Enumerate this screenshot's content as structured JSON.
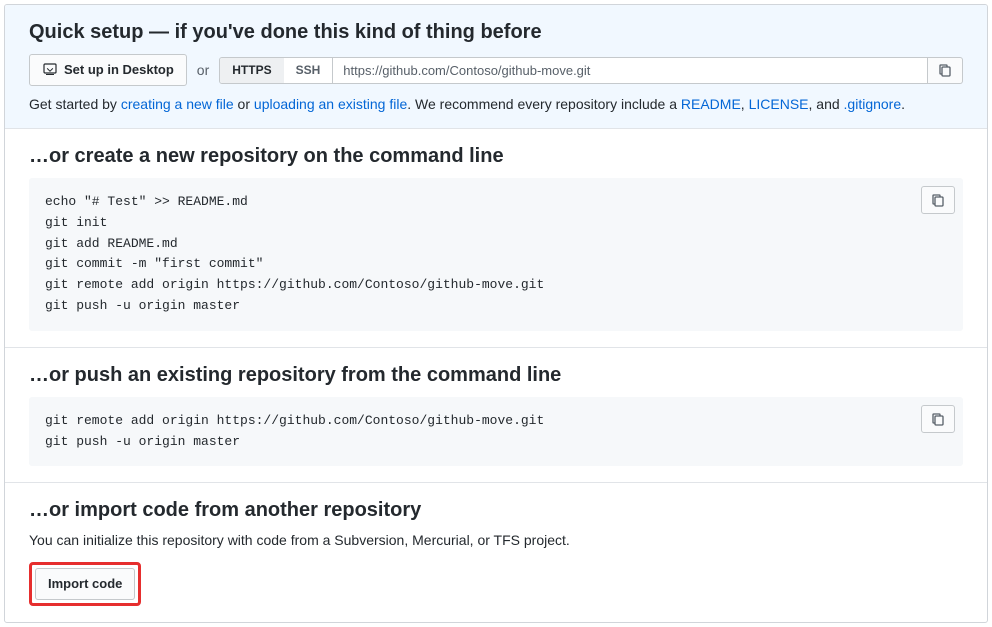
{
  "quicksetup": {
    "heading": "Quick setup — if you've done this kind of thing before",
    "desktop_button": "Set up in Desktop",
    "or": "or",
    "tabs": {
      "https": "HTTPS",
      "ssh": "SSH"
    },
    "repo_url": "https://github.com/Contoso/github-move.git",
    "help_prefix": "Get started by ",
    "link_newfile": "creating a new file",
    "help_or": " or ",
    "link_upload": "uploading an existing file",
    "help_mid": ". We recommend every repository include a ",
    "link_readme": "README",
    "sep1": ", ",
    "link_license": "LICENSE",
    "sep2": ", and ",
    "link_gitignore": ".gitignore",
    "help_end": "."
  },
  "create": {
    "heading": "…or create a new repository on the command line",
    "code": "echo \"# Test\" >> README.md\ngit init\ngit add README.md\ngit commit -m \"first commit\"\ngit remote add origin https://github.com/Contoso/github-move.git\ngit push -u origin master"
  },
  "push": {
    "heading": "…or push an existing repository from the command line",
    "code": "git remote add origin https://github.com/Contoso/github-move.git\ngit push -u origin master"
  },
  "import": {
    "heading": "…or import code from another repository",
    "desc": "You can initialize this repository with code from a Subversion, Mercurial, or TFS project.",
    "button": "Import code"
  }
}
